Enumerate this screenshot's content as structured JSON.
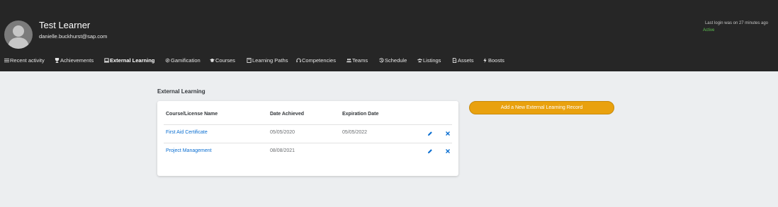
{
  "header": {
    "user_name": "Test Learner",
    "email": "danielle.buckhurst@sap.com",
    "last_login": "Last login was on 27 minutes ago",
    "status": "Active",
    "status_color": "#5dc150",
    "background": "#262626"
  },
  "nav": {
    "items": [
      {
        "label": "Recent activity",
        "icon": "list-icon",
        "active": false
      },
      {
        "label": "Achievements",
        "icon": "trophy-icon",
        "active": false
      },
      {
        "label": "External Learning",
        "icon": "laptop-icon",
        "active": true
      },
      {
        "label": "Gamification",
        "icon": "gear-icon",
        "active": false
      },
      {
        "label": "Courses",
        "icon": "graduation-cap-icon",
        "active": false
      },
      {
        "label": "Learning Paths",
        "icon": "book-icon",
        "active": false
      },
      {
        "label": "Competencies",
        "icon": "headset-icon",
        "active": false
      },
      {
        "label": "Teams",
        "icon": "people-icon",
        "active": false
      },
      {
        "label": "Schedule",
        "icon": "history-icon",
        "active": false
      },
      {
        "label": "Listings",
        "icon": "group-icon",
        "active": false
      },
      {
        "label": "Assets",
        "icon": "document-icon",
        "active": false
      },
      {
        "label": "Boosts",
        "icon": "lightning-icon",
        "active": false
      }
    ]
  },
  "main": {
    "section_title": "External Learning",
    "table": {
      "columns": [
        "Course/License Name",
        "Date Achieved",
        "Expiration Date"
      ],
      "rows": [
        {
          "name": "First Aid Certificate",
          "date_achieved": "05/05/2020",
          "expiration_date": "05/05/2022"
        },
        {
          "name": "Project Management",
          "date_achieved": "08/08/2021",
          "expiration_date": ""
        }
      ],
      "row_actions": [
        "edit-icon",
        "close-icon"
      ]
    },
    "add_button_label": "Add a New External Learning Record",
    "accent_color": "#e9a10e",
    "link_color": "#0a6ed1",
    "page_background": "#eceef0"
  }
}
